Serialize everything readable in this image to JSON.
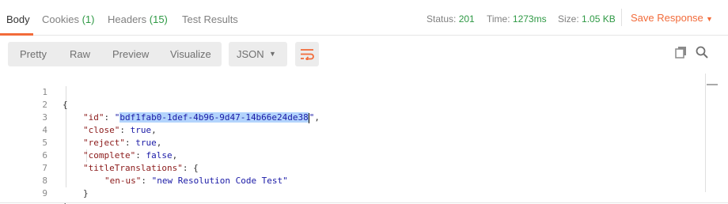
{
  "tabs": [
    {
      "label": "Body",
      "count": ""
    },
    {
      "label": "Cookies",
      "count": "(1)"
    },
    {
      "label": "Headers",
      "count": "(15)"
    },
    {
      "label": "Test Results",
      "count": ""
    }
  ],
  "status": {
    "status_label": "Status:",
    "status_value": "201",
    "time_label": "Time:",
    "time_value": "1273ms",
    "size_label": "Size:",
    "size_value": "1.05 KB"
  },
  "save_response_label": "Save Response",
  "view_modes": [
    "Pretty",
    "Raw",
    "Preview",
    "Visualize"
  ],
  "format_select": "JSON",
  "icons": {
    "wrap": "wrap-lines-icon",
    "copy": "copy-icon",
    "search": "search-icon",
    "caret": "chevron-down-icon"
  },
  "colors": {
    "accent": "#f26b3a",
    "status_green": "#2e9944",
    "json_key": "#8b1a1a",
    "json_value": "#1a1aa6",
    "selection": "#b3d4fc"
  },
  "code": {
    "line_numbers": [
      "1",
      "2",
      "3",
      "4",
      "5",
      "6",
      "7",
      "8",
      "9"
    ],
    "l1": "{",
    "l2_key": "\"id\"",
    "l2_colon": ": ",
    "l2_q1": "\"",
    "l2_sel": "bdf1fab0-1def-4b96-9d47-14b66e24de38",
    "l2_q2": "\"",
    "l2_end": ",",
    "l3_key": "\"close\"",
    "l3_colon": ": ",
    "l3_val": "true",
    "l3_end": ",",
    "l4_key": "\"reject\"",
    "l4_colon": ": ",
    "l4_val": "true",
    "l4_end": ",",
    "l5_key": "\"complete\"",
    "l5_colon": ": ",
    "l5_val": "false",
    "l5_end": ",",
    "l6_key": "\"titleTranslations\"",
    "l6_colon": ": ",
    "l6_val": "{",
    "l7_key": "\"en-us\"",
    "l7_colon": ": ",
    "l7_val": "\"new Resolution Code Test\"",
    "l8": "}",
    "l9": "}"
  }
}
